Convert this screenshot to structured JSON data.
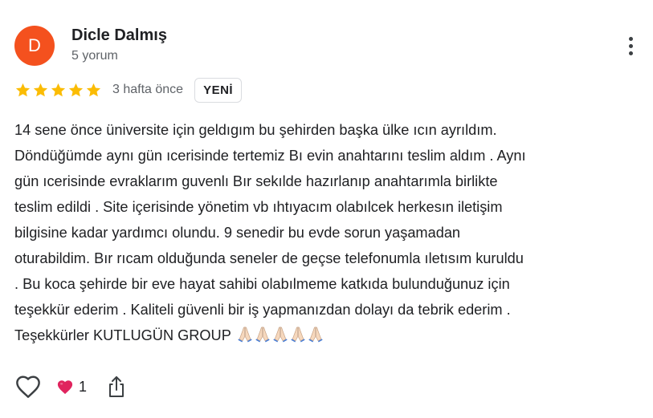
{
  "review": {
    "author": {
      "initial": "D",
      "name": "Dicle Dalmış",
      "meta": "5 yorum",
      "avatar_color": "#f4511e"
    },
    "rating": {
      "stars": 5,
      "max_stars": 5,
      "star_color": "#fbbc04",
      "age": "3 hafta önce",
      "badge": "YENİ"
    },
    "lines": [
      "14 sene önce üniversite için geldıgım bu şehirden başka ülke ıcın ayrıldım.",
      "Döndüğümde aynı gün ıcerisinde tertemiz Bı evin anahtarını teslim aldım . Aynı",
      "gün ıcerisinde evraklarım guvenlı Bır sekılde hazırlanıp anahtarımla birlikte",
      "teslim edildi . Site içerisinde yönetim vb ıhtıyacım olabılcek herkesın iletişim",
      "bilgisine kadar yardımcı olundu. 9 senedir bu evde sorun yaşamadan",
      "oturabildim. Bır rıcam olduğunda seneler de geçse telefonumla ıletısım kuruldu",
      ". Bu koca şehirde bir eve hayat sahibi olabılmeme katkıda bulunduğunuz için",
      "teşekkür ederim . Kaliteli güvenli bir iş yapmanızdan dolayı da tebrik ederim .",
      "Teşekkürler KUTLUGÜN GROUP"
    ],
    "emoji": {
      "name": "folded-hands-emoji",
      "count": 5
    },
    "actions": {
      "like_icon": "heart-outline-icon",
      "reaction_icon": "red-heart-icon",
      "reaction_color": "#e0245e",
      "reaction_count": "1",
      "share_icon": "share-icon"
    }
  }
}
